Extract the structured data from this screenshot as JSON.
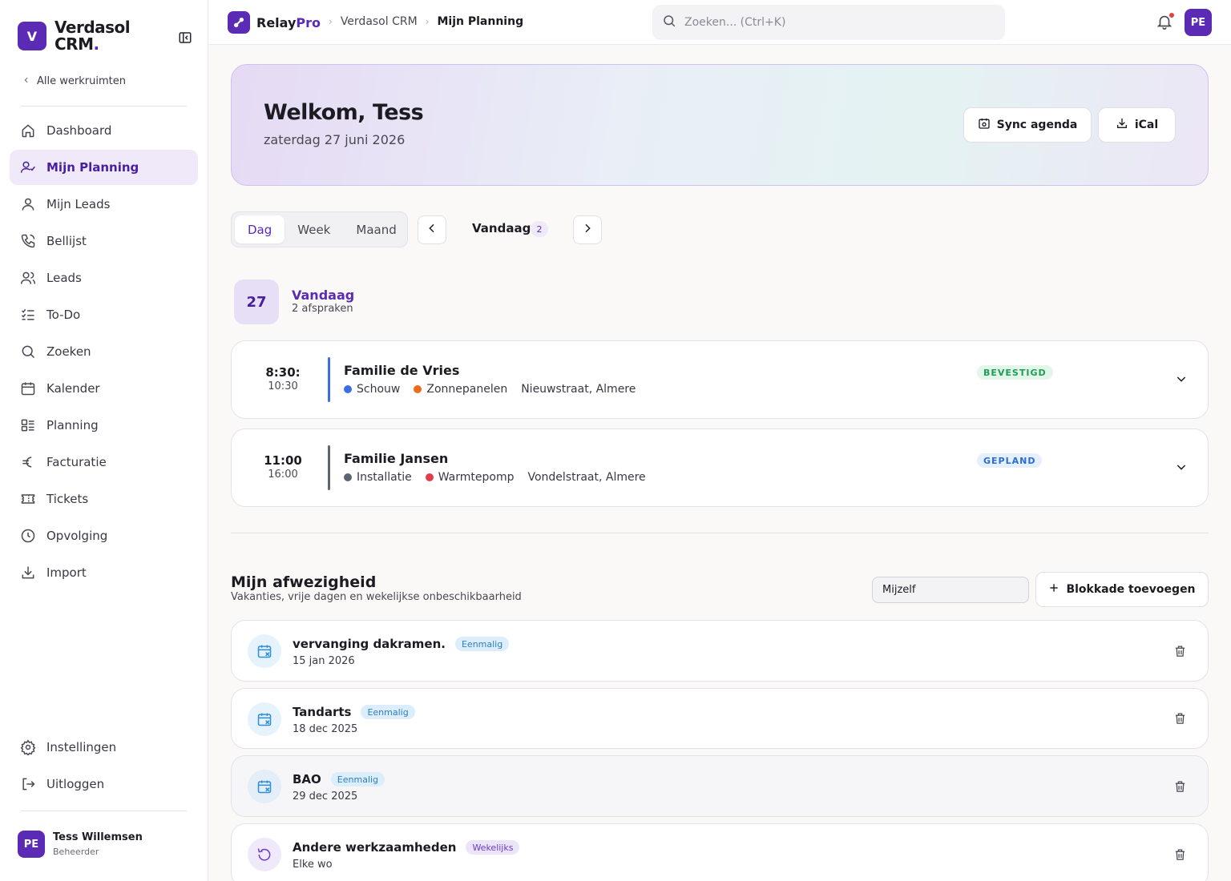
{
  "colors": {
    "brand": "#5b2bb5",
    "confirmed": "#1f9d55",
    "planned": "#2b6cd4"
  },
  "sidebar": {
    "brand_initial": "V",
    "brand_name": "Verdasol",
    "brand_suffix": "CRM",
    "brand_dot": ".",
    "back_label": "Alle werkruimten",
    "items": [
      {
        "label": "Dashboard",
        "icon": "home-icon"
      },
      {
        "label": "Mijn Planning",
        "icon": "user-check-icon"
      },
      {
        "label": "Mijn Leads",
        "icon": "user-icon"
      },
      {
        "label": "Bellijst",
        "icon": "phone-icon"
      },
      {
        "label": "Leads",
        "icon": "users-icon"
      },
      {
        "label": "To-Do",
        "icon": "checklist-icon"
      },
      {
        "label": "Zoeken",
        "icon": "search-icon"
      },
      {
        "label": "Kalender",
        "icon": "calendar-icon"
      },
      {
        "label": "Planning",
        "icon": "kanban-icon"
      },
      {
        "label": "Facturatie",
        "icon": "euro-icon"
      },
      {
        "label": "Tickets",
        "icon": "ticket-icon"
      },
      {
        "label": "Opvolging",
        "icon": "clock-icon"
      },
      {
        "label": "Import",
        "icon": "download-icon"
      }
    ],
    "bottom": [
      {
        "label": "Instellingen",
        "icon": "gear-icon"
      },
      {
        "label": "Uitloggen",
        "icon": "logout-icon"
      }
    ],
    "user": {
      "initials": "PE",
      "name": "Tess Willemsen",
      "role": "Beheerder"
    }
  },
  "topbar": {
    "app_name": "Relay",
    "app_suffix": "Pro",
    "breadcrumbs": [
      "Verdasol CRM",
      "Mijn Planning"
    ],
    "search_placeholder": "Zoeken... (Ctrl+K)",
    "avatar_initials": "PE"
  },
  "hero": {
    "title": "Welkom, Tess",
    "date": "zaterdag 27 juni 2026",
    "sync_label": "Sync agenda",
    "ical_label": "iCal"
  },
  "views": {
    "tabs": [
      "Dag",
      "Week",
      "Maand"
    ],
    "active": "Dag",
    "today_label": "Vandaag",
    "today_count": "2"
  },
  "day": {
    "number": "27",
    "title": "Vandaag",
    "subtitle": "2 afspraken"
  },
  "appointments": [
    {
      "start": "8:30:",
      "end": "10:30",
      "name": "Familie de Vries",
      "type": "Schouw",
      "type_color": "#3b6ee6",
      "product": "Zonnepanelen",
      "product_color": "#ee6a1c",
      "address": "Nieuwstraat, Almere",
      "status": "BEVESTIGD",
      "bar_color": "#3b6ee6"
    },
    {
      "start": "11:00",
      "end": "16:00",
      "name": "Familie Jansen",
      "type": "Installatie",
      "type_color": "#5e6472",
      "product": "Warmtepomp",
      "product_color": "#e23d4a",
      "address": "Vondelstraat, Almere",
      "status": "GEPLAND",
      "bar_color": "#5e6472"
    }
  ],
  "absence": {
    "title": "Mijn afwezigheid",
    "subtitle": "Vakanties, vrije dagen en wekelijkse onbeschikbaarheid",
    "filter_value": "Mijzelf",
    "add_label": "Blokkade toevoegen",
    "items": [
      {
        "name": "vervanging dakramen.",
        "tag": "Eenmalig",
        "date": "15 jan 2026",
        "icon": "calendar-x-icon"
      },
      {
        "name": "Tandarts",
        "tag": "Eenmalig",
        "date": "18 dec 2025",
        "icon": "calendar-x-icon"
      },
      {
        "name": "BAO",
        "tag": "Eenmalig",
        "date": "29 dec 2025",
        "icon": "calendar-x-icon"
      },
      {
        "name": "Andere werkzaamheden",
        "tag": "Wekelijks",
        "date": "Elke wo",
        "icon": "repeat-icon"
      }
    ]
  }
}
